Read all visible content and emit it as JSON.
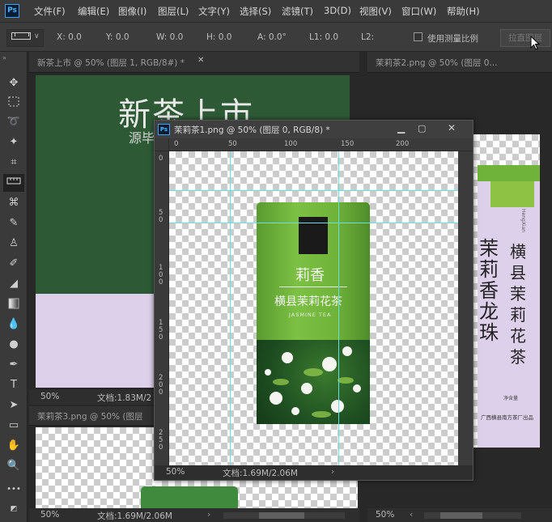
{
  "menu": {
    "logo": "Ps",
    "items": [
      "文件(F)",
      "编辑(E)",
      "图像(I)",
      "图层(L)",
      "文字(Y)",
      "选择(S)",
      "滤镜(T)",
      "3D(D)",
      "视图(V)",
      "窗口(W)",
      "帮助(H)"
    ]
  },
  "options": {
    "x": "X: 0.0",
    "y": "Y: 0.0",
    "w": "W: 0.0",
    "h": "H: 0.0",
    "a": "A: 0.0°",
    "l1": "L1: 0.0",
    "l2": "L2:",
    "use_scale": "使用测量比例",
    "straighten": "拉直图层"
  },
  "tabs": {
    "left": "新茶上市 @ 50% (图层 1, RGB/8#) *",
    "right": "茉莉茶2.png @ 50% (图层 0...",
    "bottom_left": "茉莉茶3.png @ 50% (图层"
  },
  "floating": {
    "title": "茉莉茶1.png @ 50% (图层 0, RGB/8) *",
    "status_zoom": "50%",
    "status_doc": "文档:1.69M/2.06M",
    "ruler_h": [
      "0",
      "50",
      "100",
      "150",
      "200"
    ],
    "ruler_v": [
      "0",
      "50",
      "100",
      "150",
      "200",
      "250"
    ]
  },
  "left_doc": {
    "headline": "新茶上市",
    "subline": "源毕",
    "status_zoom": "50%",
    "status_doc": "文档:1.83M/2"
  },
  "bottom_doc": {
    "status_zoom": "50%",
    "status_doc": "文档:1.69M/2.06M"
  },
  "right_doc": {
    "status_zoom": "50%",
    "title_chars": "茉莉香龙珠",
    "subtitle_chars": "横县茉莉花茶",
    "latin": "HengXian",
    "vendor": "广西横县南方茶厂出品",
    "net": "净含量"
  },
  "tin": {
    "brand": "莉香",
    "name": "横县茉莉花茶",
    "english": "JASMINE TEA"
  },
  "colors": {
    "tin_green": "#6fb33a",
    "dark_green": "#2d5a35",
    "lavender": "#ddd0ea",
    "guide": "#66e0e0"
  }
}
